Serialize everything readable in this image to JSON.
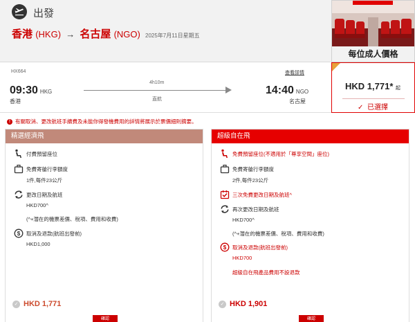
{
  "header": {
    "depart_label": "出發",
    "origin_city": "香港",
    "origin_code": "(HKG)",
    "dest_city": "名古屋",
    "dest_code": "(NGO)",
    "date": "2025年7月11日星期五"
  },
  "fare_column": {
    "caption": "每位成人價格",
    "price": "HKD 1,771",
    "price_suffix": "*",
    "price_up": "起",
    "selected_label": "已選擇"
  },
  "flight": {
    "number": "HX664",
    "details_link": "查看詳情",
    "dep_time": "09:30",
    "dep_code": "HKG",
    "dep_city": "香港",
    "duration": "4h10m",
    "stops": "直航",
    "arr_time": "14:40",
    "arr_code": "NGO",
    "arr_city": "名古屋"
  },
  "notice": "有關取消、更改航班手續費及未能你得發機費用的詳情將展示於票價細則摘要。",
  "cards": {
    "economy": {
      "title": "精選經濟飛",
      "seat": "付費預留座位",
      "baggage": "免費寄艙行李額度",
      "baggage_detail": "1件,每件23公斤",
      "change": "更改日期及航班",
      "change_fee": "HKD700^",
      "change_note": "(^+潛在的機票差價、稅項、費用和收費)",
      "cancel": "取消及退款(航班出發前)",
      "cancel_fee": "HKD1,000",
      "total": "HKD 1,771",
      "confirm": "確認"
    },
    "superior": {
      "title": "超級自在飛",
      "seat": "免費預留座位(不適用於「尊享空間」座位)",
      "baggage": "免費寄艙行李額度",
      "baggage_detail": "2件,每件23公斤",
      "free_change": "三次免費更改日期及航班^",
      "change": "再次更改日期及航班",
      "change_fee": "HKD700^",
      "change_note": "(^+潛在的機票差價、稅項、費用和收費)",
      "cancel": "取消及退款(航班出發前)",
      "cancel_fee": "HKD700",
      "refund_note": "超級自在飛產品費用不設退款",
      "total": "HKD 1,901",
      "confirm": "確認"
    }
  },
  "colors": {
    "brand_red": "#e60000",
    "economy_header": "#c1897a",
    "accent_gold": "#e8a33b"
  }
}
